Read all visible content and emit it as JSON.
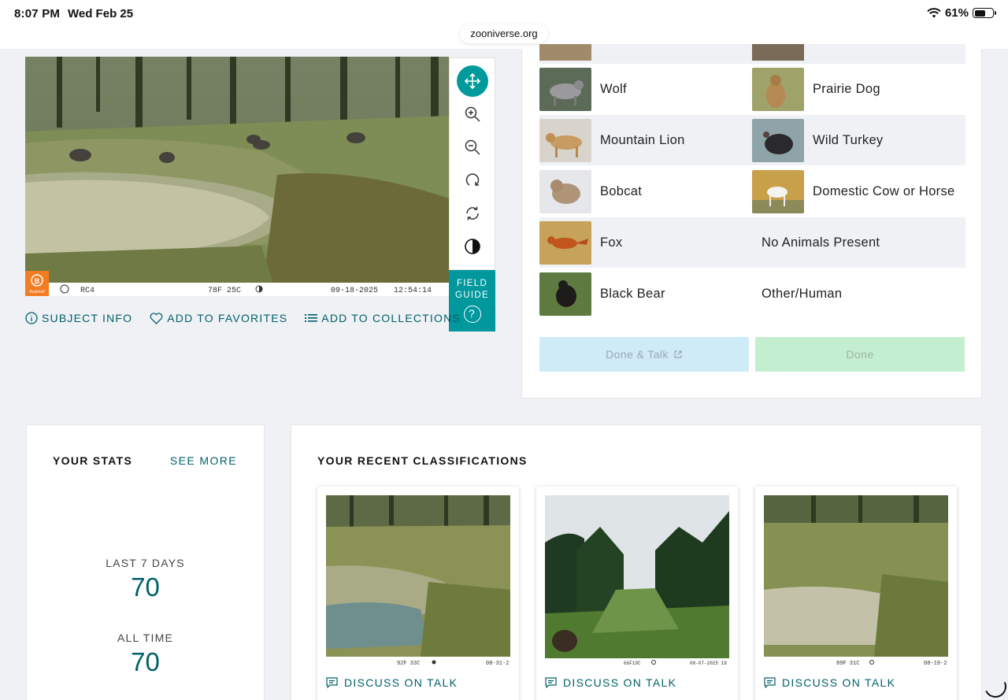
{
  "status_bar": {
    "time": "8:07 PM",
    "date": "Wed Feb 25",
    "battery": "61%",
    "battery_level": 0.61,
    "url": "zooniverse.org"
  },
  "subject": {
    "camera_brand": "Bushnell",
    "camera_id": "RC4",
    "temperature": "78F 25C",
    "date": "09-18-2025",
    "time": "12:54:14"
  },
  "toolbar": {
    "tools": [
      "move-icon",
      "zoom-in-icon",
      "zoom-out-icon",
      "rotate-icon",
      "reset-icon",
      "invert-icon"
    ],
    "field_guide_label": "FIELD GUIDE",
    "field_guide_help": "?"
  },
  "subject_actions": {
    "info": "SUBJECT INFO",
    "favorites": "ADD TO FAVORITES",
    "collections": "ADD TO COLLECTIONS"
  },
  "choices": {
    "rows": [
      {
        "left": {
          "label": "Wolf"
        },
        "right": {
          "label": "Prairie Dog"
        }
      },
      {
        "left": {
          "label": "Mountain Lion"
        },
        "right": {
          "label": "Wild Turkey"
        }
      },
      {
        "left": {
          "label": "Bobcat"
        },
        "right": {
          "label": "Domestic Cow or Horse"
        }
      },
      {
        "left": {
          "label": "Fox"
        },
        "right": {
          "label": "No Animals Present"
        }
      },
      {
        "left": {
          "label": "Black Bear"
        },
        "right": {
          "label": "Other/Human"
        }
      }
    ],
    "done_talk_label": "Done & Talk",
    "done_label": "Done"
  },
  "stats": {
    "title": "YOUR STATS",
    "see_more": "SEE MORE",
    "last7_label": "LAST 7 DAYS",
    "last7_value": "70",
    "alltime_label": "ALL TIME",
    "alltime_value": "70"
  },
  "recent": {
    "title": "YOUR RECENT CLASSIFICATIONS",
    "cards": [
      {
        "overlay": "92F 33C",
        "date": "08-31-2",
        "talk": "DISCUSS ON TALK"
      },
      {
        "overlay": "66F19C",
        "date": "08-07-2025 18",
        "talk": "DISCUSS ON TALK"
      },
      {
        "overlay": "89F 31C",
        "date": "08-19-2",
        "talk": "DISCUSS ON TALK"
      }
    ]
  },
  "colors": {
    "teal": "#00979d",
    "link": "#00606b",
    "done_talk_bg": "#cfebf8",
    "done_bg": "#c4eed0"
  }
}
